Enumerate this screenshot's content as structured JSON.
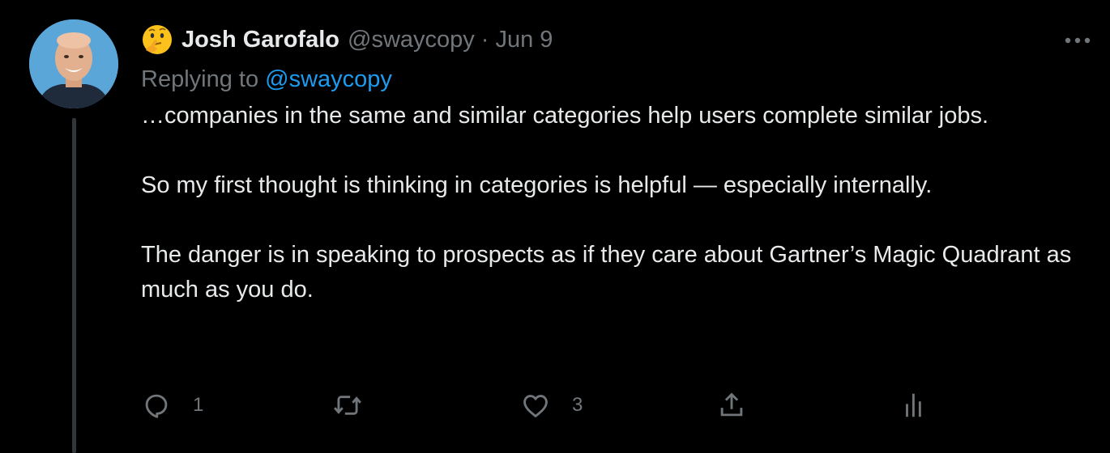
{
  "author": {
    "name": "Josh Garofalo",
    "handle": "@swaycopy",
    "separator": "·",
    "date": "Jun 9",
    "emoji_icon": "thinking-face-icon"
  },
  "reply": {
    "prefix": "Replying to",
    "mention": "@swaycopy"
  },
  "body": {
    "paragraphs": [
      "…companies in the same and similar categories help users complete similar jobs.",
      "So my first thought is thinking in categories is helpful — especially internally.",
      "The danger is in speaking to prospects as if they care about Gartner’s Magic Quadrant as much as you do."
    ]
  },
  "actions": {
    "reply": {
      "icon": "reply-icon",
      "count": "1"
    },
    "retweet": {
      "icon": "retweet-icon",
      "count": ""
    },
    "like": {
      "icon": "heart-icon",
      "count": "3"
    },
    "share": {
      "icon": "share-icon"
    },
    "analytics": {
      "icon": "analytics-icon"
    }
  },
  "colors": {
    "background": "#000000",
    "text": "#e7e9ea",
    "muted": "#71767b",
    "link": "#1d9bf0"
  }
}
